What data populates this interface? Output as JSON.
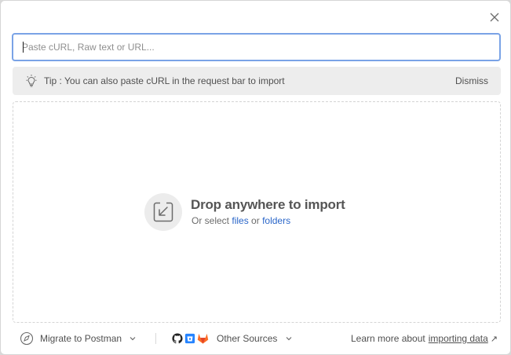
{
  "search": {
    "placeholder": "Paste cURL, Raw text or URL..."
  },
  "tip": {
    "text": "Tip : You can also paste cURL in the request bar to import",
    "dismiss_label": "Dismiss"
  },
  "drop_zone": {
    "title": "Drop anywhere to import",
    "sub_prefix": "Or select",
    "files_link": "files",
    "sub_or": "or",
    "folders_link": "folders"
  },
  "footer": {
    "migrate_label": "Migrate to Postman",
    "other_sources_label": "Other Sources",
    "learn_prefix": "Learn more about",
    "learn_link": "importing data",
    "learn_arrow": "↗"
  },
  "icons": {
    "close": "close-icon",
    "tip": "lightbulb-icon",
    "drop": "import-icon",
    "migrate": "compass-icon",
    "github": "github-icon",
    "bitbucket": "bitbucket-icon",
    "gitlab": "gitlab-icon",
    "chevron": "chevron-down-icon"
  },
  "colors": {
    "focus_border": "#7aa3e6",
    "link": "#2a66c9",
    "tip_bg": "#ededed",
    "gitlab": "#e24329",
    "bitbucket": "#2684ff"
  }
}
